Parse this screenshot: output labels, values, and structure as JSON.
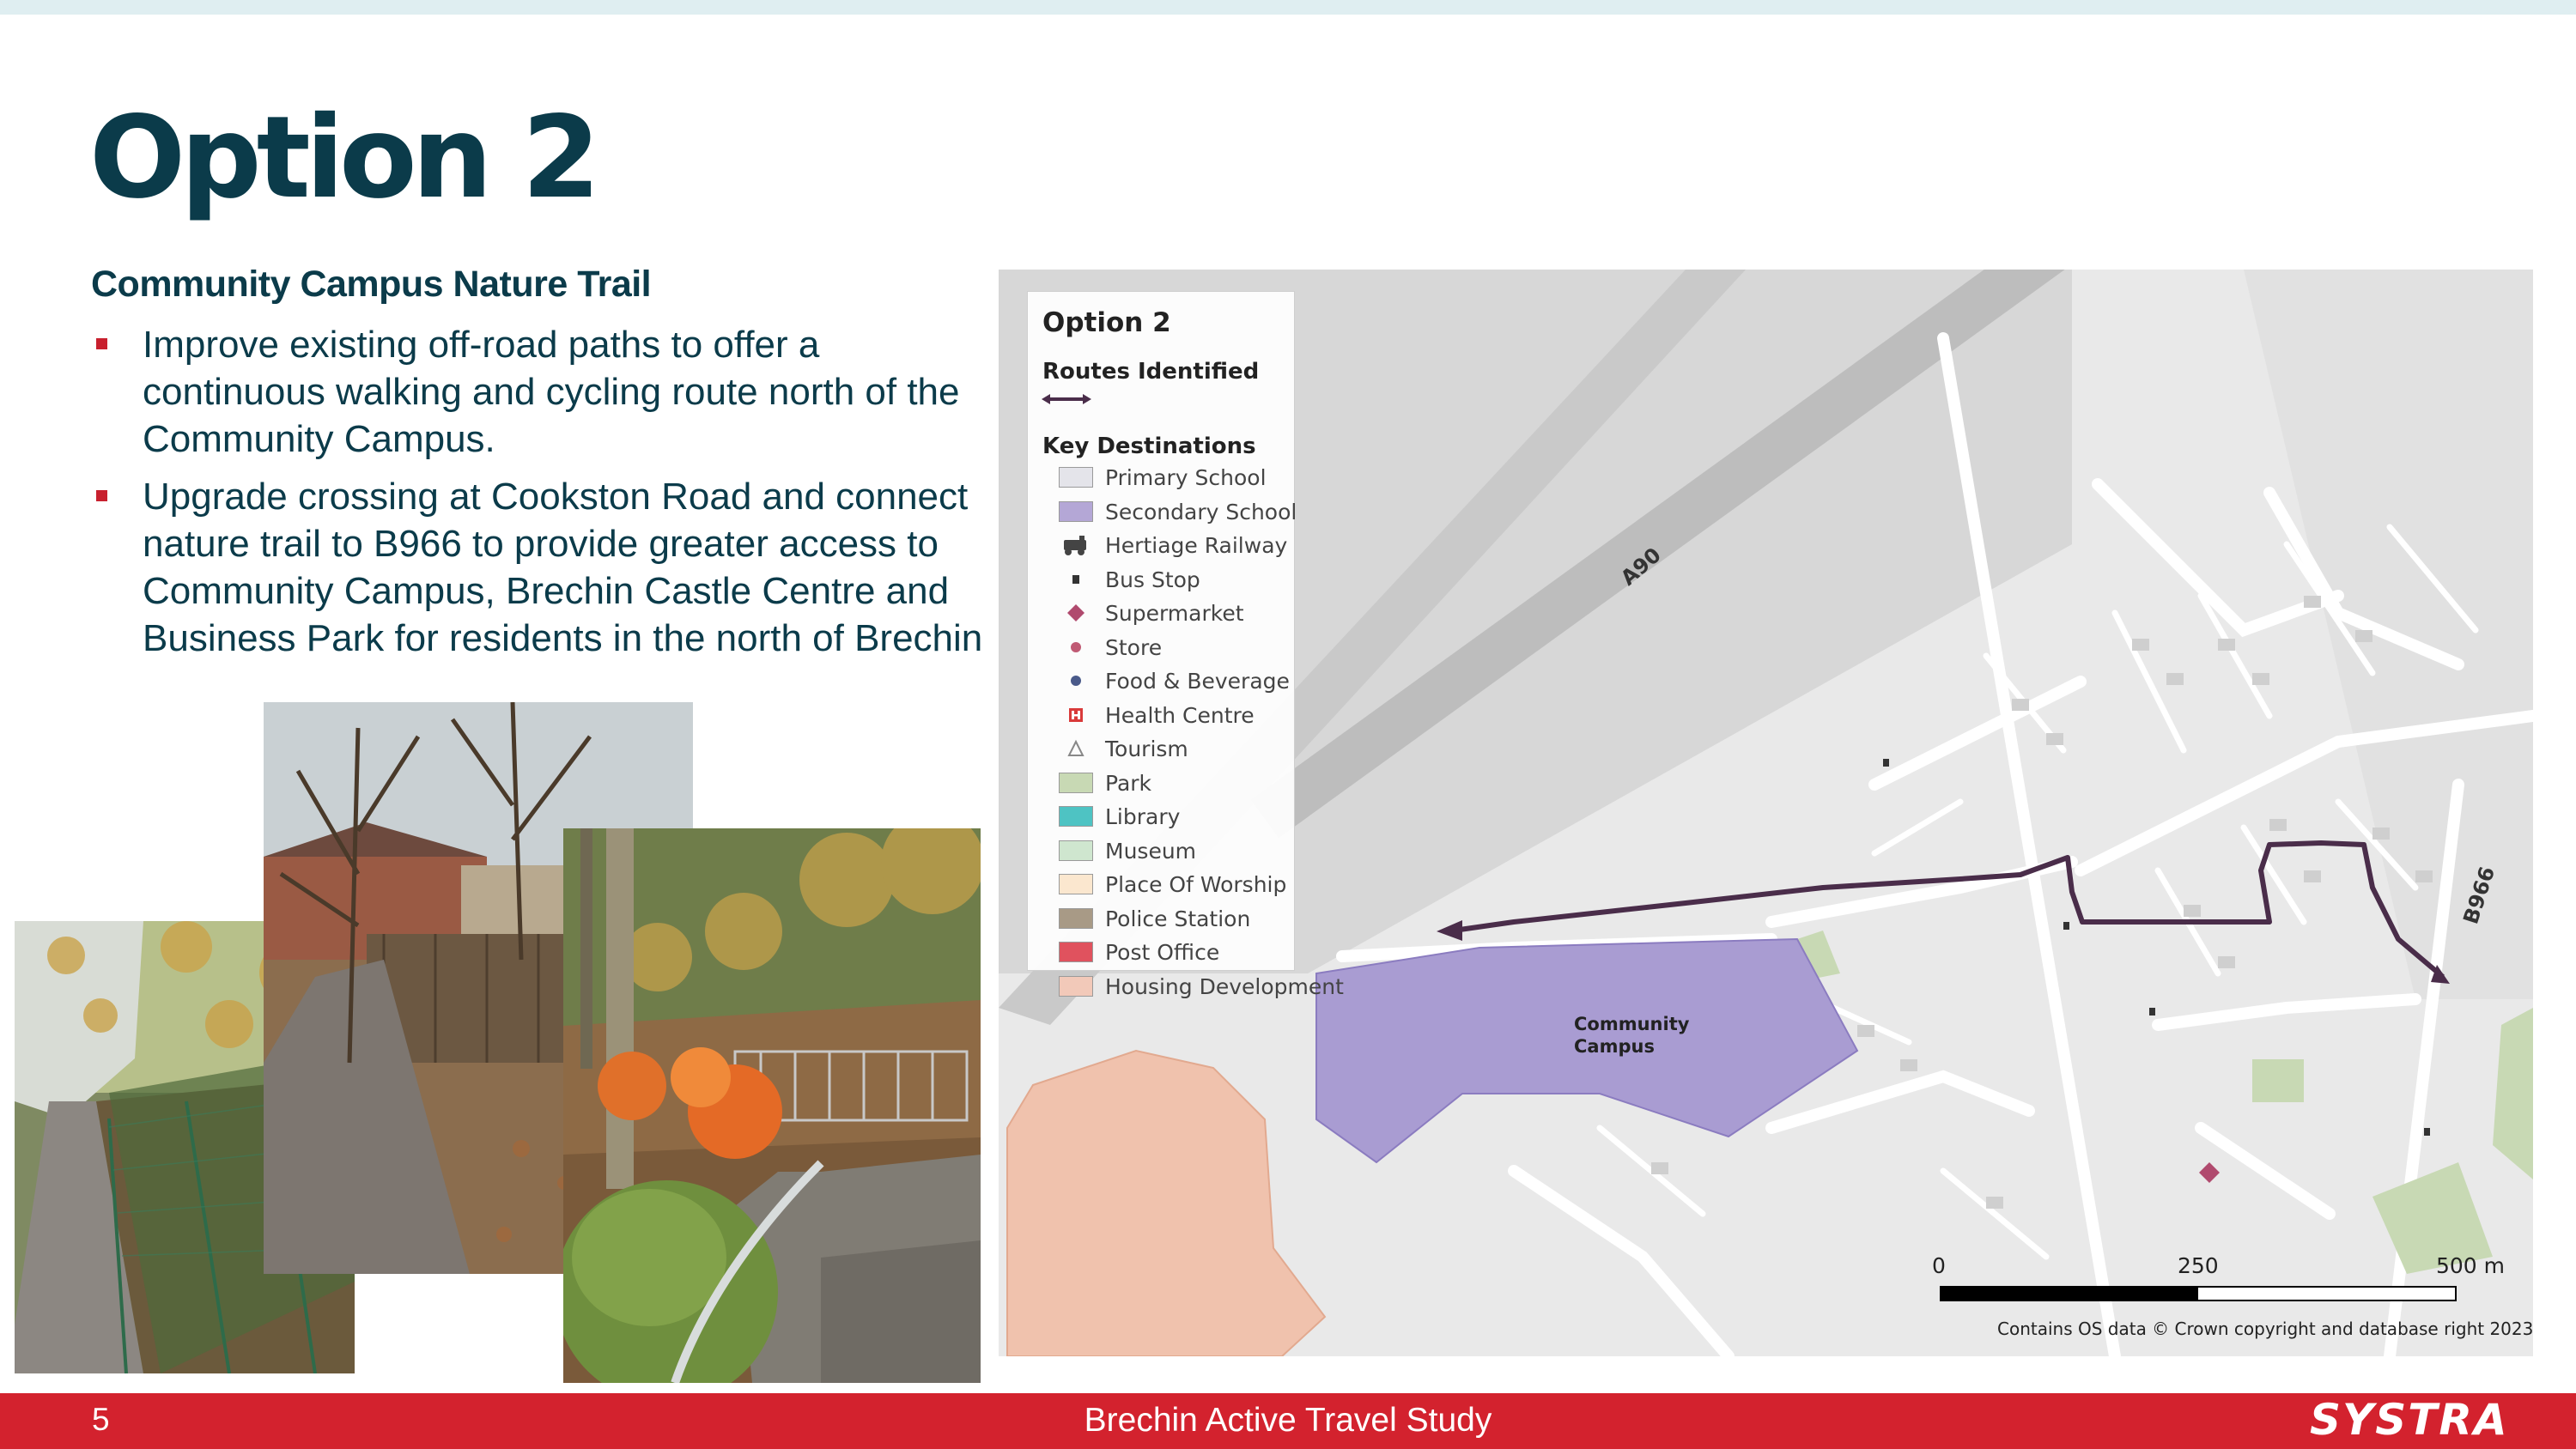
{
  "slide": {
    "title": "Option 2",
    "subtitle": "Community Campus Nature Trail",
    "bullets": [
      "Improve existing off-road paths to offer a continuous walking and cycling route north of the Community Campus.",
      "Upgrade crossing at Cookston Road and connect nature trail to B966 to provide greater access to Community Campus, Brechin Castle Centre and Business Park for residents in the north of Brechin"
    ]
  },
  "map": {
    "legend": {
      "title": "Option 2",
      "routes_heading": "Routes Identified",
      "key_heading": "Key Destinations",
      "items": [
        {
          "label": "Primary School",
          "kind": "swatch",
          "color": "#e4e4ea"
        },
        {
          "label": "Secondary School",
          "kind": "swatch",
          "color": "#b4a7d6"
        },
        {
          "label": "Hertiage Railway",
          "kind": "train-icon",
          "color": "#444444"
        },
        {
          "label": "Bus Stop",
          "kind": "bus-stop-icon",
          "color": "#333333"
        },
        {
          "label": "Supermarket",
          "kind": "diamond-icon",
          "color": "#b04a6e"
        },
        {
          "label": "Store",
          "kind": "dot-icon",
          "color": "#c05a74"
        },
        {
          "label": "Food & Beverage",
          "kind": "dot-icon",
          "color": "#4a5a8a"
        },
        {
          "label": "Health Centre",
          "kind": "health-icon",
          "color": "#d93a3a"
        },
        {
          "label": "Tourism",
          "kind": "triangle-icon",
          "color": "#888888"
        },
        {
          "label": "Park",
          "kind": "swatch",
          "color": "#c8d9b4"
        },
        {
          "label": "Library",
          "kind": "swatch",
          "color": "#4ec3c3"
        },
        {
          "label": "Museum",
          "kind": "swatch",
          "color": "#cfe6cf"
        },
        {
          "label": "Place Of Worship",
          "kind": "swatch",
          "color": "#fbe7cf"
        },
        {
          "label": "Police Station",
          "kind": "swatch",
          "color": "#a89a86"
        },
        {
          "label": "Post Office",
          "kind": "swatch",
          "color": "#e0525e"
        },
        {
          "label": "Housing Development",
          "kind": "swatch",
          "color": "#f2c9b9"
        }
      ]
    },
    "labels": {
      "road_a90": "A90",
      "road_b966": "B966",
      "campus": "Community Campus"
    },
    "scale": {
      "zero": "0",
      "mid": "250",
      "max": "500 m"
    },
    "attribution": "Contains OS data © Crown copyright and database right 2023",
    "colors": {
      "route": "#4a2d4a",
      "secondary_school": "#a99cd2",
      "housing_development": "#f0c2ad"
    }
  },
  "footer": {
    "page_number": "5",
    "title": "Brechin Active Travel Study",
    "brand": "SYSTRA"
  }
}
